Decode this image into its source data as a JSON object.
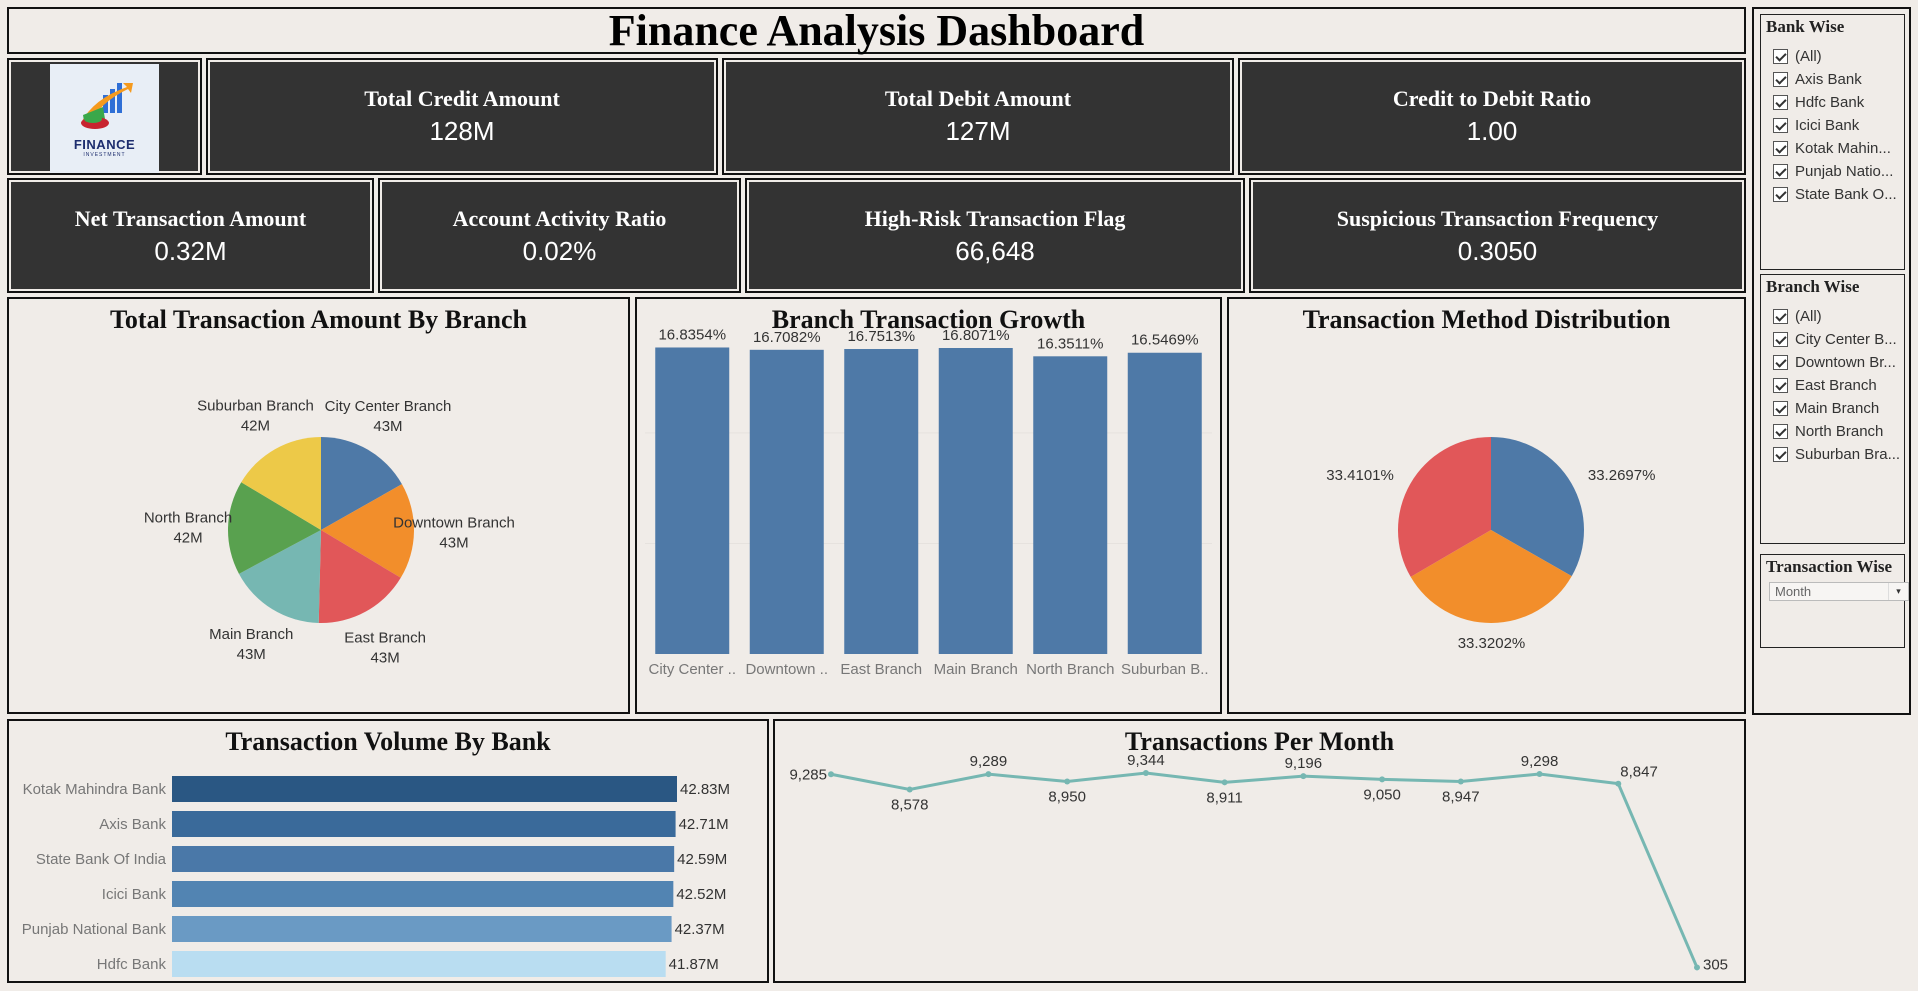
{
  "header": {
    "title": "Finance Analysis Dashboard"
  },
  "logo": {
    "text": "FINANCE",
    "subtext": "INVESTMENT"
  },
  "kpis": [
    {
      "label": "Total Credit Amount",
      "value": "128M"
    },
    {
      "label": "Total Debit Amount",
      "value": "127M"
    },
    {
      "label": "Credit to Debit Ratio",
      "value": "1.00"
    },
    {
      "label": "Net Transaction Amount",
      "value": "0.32M"
    },
    {
      "label": "Account Activity Ratio",
      "value": "0.02%"
    },
    {
      "label": "High-Risk Transaction Flag",
      "value": "66,648"
    },
    {
      "label": "Suspicious Transaction Frequency",
      "value": "0.3050"
    }
  ],
  "filters": {
    "bank": {
      "title": "Bank Wise",
      "items": [
        "(All)",
        "Axis Bank",
        "Hdfc Bank",
        "Icici Bank",
        "Kotak Mahin...",
        "Punjab Natio...",
        "State Bank O..."
      ]
    },
    "branch": {
      "title": "Branch Wise",
      "items": [
        "(All)",
        "City Center B...",
        "Downtown Br...",
        "East Branch",
        "Main Branch",
        "North Branch",
        "Suburban Bra..."
      ]
    },
    "transaction": {
      "title": "Transaction Wise",
      "selected": "Month",
      "arrow": "▾"
    }
  },
  "colors": {
    "kpi_bg": "#333333",
    "bar_blue": "#4e79a7",
    "line_teal": "#76b7b2",
    "page_bg": "#f0ece8"
  },
  "chart_data": [
    {
      "id": "branch_pie",
      "type": "pie",
      "title": "Total Transaction Amount By Branch",
      "slices": [
        {
          "name": "City Center Branch",
          "value": 43,
          "label": "43M",
          "color": "#4e79a7"
        },
        {
          "name": "Downtown Branch",
          "value": 43,
          "label": "43M",
          "color": "#f28e2b"
        },
        {
          "name": "East Branch",
          "value": 43,
          "label": "43M",
          "color": "#e15759"
        },
        {
          "name": "Main Branch",
          "value": 43,
          "label": "43M",
          "color": "#76b7b2"
        },
        {
          "name": "North Branch",
          "value": 42,
          "label": "42M",
          "color": "#59a14f"
        },
        {
          "name": "Suburban Branch",
          "value": 42,
          "label": "42M",
          "color": "#edc948"
        }
      ]
    },
    {
      "id": "growth_bar",
      "type": "bar",
      "title": "Branch Transaction Growth",
      "categories": [
        "City Center ..",
        "Downtown ..",
        "East Branch",
        "Main Branch",
        "North Branch",
        "Suburban B.."
      ],
      "values": [
        16.8354,
        16.7082,
        16.7513,
        16.8071,
        16.3511,
        16.5469
      ],
      "labels": [
        "16.8354%",
        "16.7082%",
        "16.7513%",
        "16.8071%",
        "16.3511%",
        "16.5469%"
      ],
      "ylim": [
        0,
        18.4
      ],
      "grid": true,
      "color": "#4e79a7"
    },
    {
      "id": "method_pie",
      "type": "pie",
      "title": "Transaction Method Distribution",
      "slices": [
        {
          "value": 33.2697,
          "label": "33.2697%",
          "color": "#4e79a7"
        },
        {
          "value": 33.3202,
          "label": "33.3202%",
          "color": "#f28e2b"
        },
        {
          "value": 33.4101,
          "label": "33.4101%",
          "color": "#e15759"
        }
      ]
    },
    {
      "id": "bank_hbar",
      "type": "bar",
      "orientation": "horizontal",
      "title": "Transaction Volume By Bank",
      "categories": [
        "Kotak Mahindra Bank",
        "Axis Bank",
        "State Bank Of India",
        "Icici Bank",
        "Punjab National Bank",
        "Hdfc Bank"
      ],
      "values": [
        42.83,
        42.71,
        42.59,
        42.52,
        42.37,
        41.87
      ],
      "labels": [
        "42.83M",
        "42.71M",
        "42.59M",
        "42.52M",
        "42.37M",
        "41.87M"
      ],
      "colors": [
        "#2a5783",
        "#3a6a9a",
        "#4a78a8",
        "#5284b2",
        "#6a9ac4",
        "#b9ddf1"
      ],
      "xlim": [
        0,
        43
      ]
    },
    {
      "id": "month_line",
      "type": "line",
      "title": "Transactions Per Month",
      "values": [
        9285,
        8578,
        9289,
        8950,
        9344,
        8911,
        9196,
        9050,
        8947,
        9298,
        8847,
        305
      ],
      "labels": [
        "9,285",
        "8,578",
        "9,289",
        "8,950",
        "9,344",
        "8,911",
        "9,196",
        "9,050",
        "8,947",
        "9,298",
        "8,847",
        "305"
      ],
      "color": "#76b7b2"
    }
  ]
}
